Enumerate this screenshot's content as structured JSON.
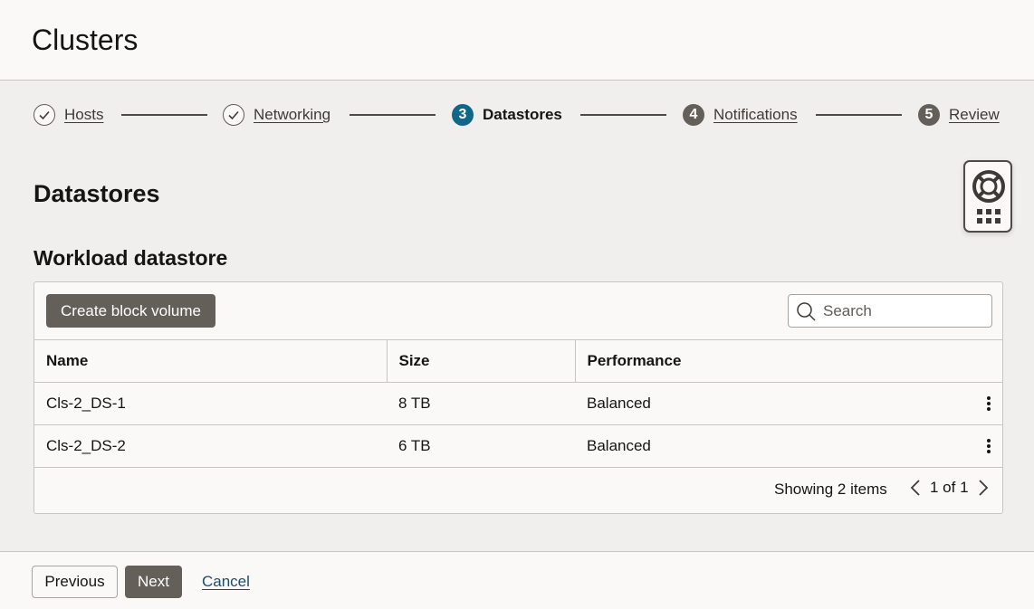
{
  "page": {
    "title": "Clusters"
  },
  "wizard": {
    "steps": [
      {
        "label": "Hosts",
        "state": "done",
        "icon": "check-icon"
      },
      {
        "label": "Networking",
        "state": "done",
        "icon": "check-icon"
      },
      {
        "number": "3",
        "label": "Datastores",
        "state": "current"
      },
      {
        "number": "4",
        "label": "Notifications",
        "state": "pending"
      },
      {
        "number": "5",
        "label": "Review",
        "state": "pending"
      }
    ]
  },
  "section": {
    "title": "Datastores",
    "subtitle": "Workload datastore"
  },
  "toolbar": {
    "create_label": "Create block volume",
    "search_placeholder": "Search"
  },
  "table": {
    "columns": [
      "Name",
      "Size",
      "Performance"
    ],
    "rows": [
      {
        "name": "Cls-2_DS-1",
        "size": "8 TB",
        "performance": "Balanced"
      },
      {
        "name": "Cls-2_DS-2",
        "size": "6 TB",
        "performance": "Balanced"
      }
    ],
    "showing": "Showing 2 items",
    "page_info": "1 of 1"
  },
  "footer": {
    "previous_label": "Previous",
    "next_label": "Next",
    "cancel_label": "Cancel"
  },
  "colors": {
    "accent": "#0f6789",
    "button_dark": "#655f5a",
    "page_bg": "#f1efed"
  },
  "icons": {
    "help": "lifebuoy-icon",
    "apps": "grid-icon"
  }
}
